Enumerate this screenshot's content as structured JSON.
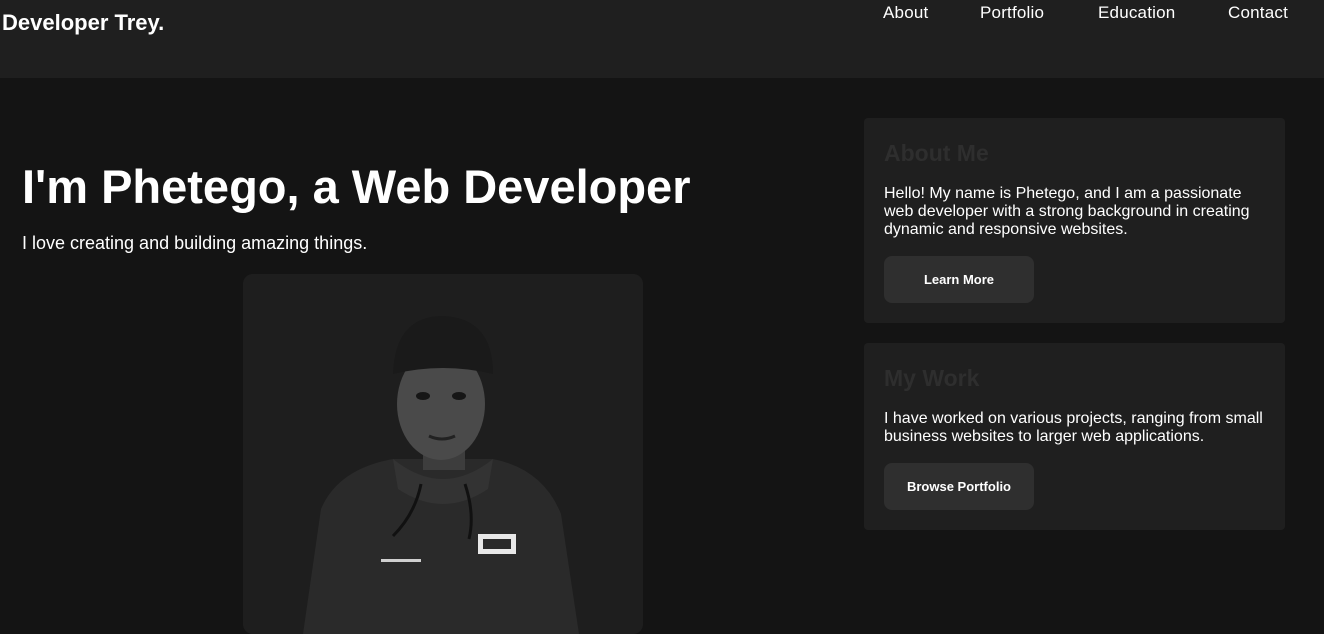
{
  "nav": {
    "brand": "Developer Trey.",
    "links": [
      "About",
      "Portfolio",
      "Education",
      "Contact"
    ]
  },
  "hero": {
    "title": "I'm Phetego, a Web Developer",
    "subtitle": "I love creating and building amazing things."
  },
  "about_card": {
    "title": "About Me",
    "text": "Hello! My name is Phetego, and I am a passionate web developer with a strong background in creating dynamic and responsive websites.",
    "button": "Learn More"
  },
  "work_card": {
    "title": "My Work",
    "text": "I have worked on various projects, ranging from small business websites to larger web applications.",
    "button": "Browse Portfolio"
  },
  "colors": {
    "page_bg": "#141414",
    "surface": "#1f1f1f",
    "button": "#2f2f2f",
    "card_title": "#2e2e2e",
    "text": "#ffffff"
  }
}
